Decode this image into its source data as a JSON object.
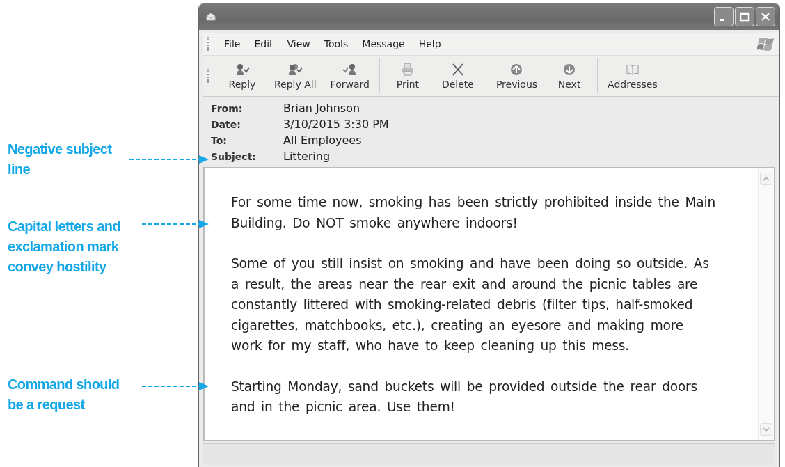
{
  "callouts": [
    {
      "text": "Negative subject line"
    },
    {
      "text": "Capital letters and exclamation mark convey hostility"
    },
    {
      "text": "Command should be a request"
    }
  ],
  "window": {
    "menu": [
      "File",
      "Edit",
      "View",
      "Tools",
      "Message",
      "Help"
    ],
    "toolbar_groups": [
      [
        {
          "label": "Reply",
          "kind": "reply"
        },
        {
          "label": "Reply All",
          "kind": "replyall"
        },
        {
          "label": "Forward",
          "kind": "forward"
        }
      ],
      [
        {
          "label": "Print",
          "kind": "print"
        },
        {
          "label": "Delete",
          "kind": "delete"
        }
      ],
      [
        {
          "label": "Previous",
          "kind": "previous"
        },
        {
          "label": "Next",
          "kind": "next"
        }
      ],
      [
        {
          "label": "Addresses",
          "kind": "addresses"
        }
      ]
    ],
    "header": [
      {
        "label": "From:",
        "value": "Brian Johnson"
      },
      {
        "label": "Date:",
        "value": "3/10/2015 3:30 PM"
      },
      {
        "label": "To:",
        "value": "All Employees"
      },
      {
        "label": "Subject:",
        "value": "Littering"
      }
    ],
    "body": [
      "For some time now, smoking has been strictly prohibited inside the Main Building. Do NOT smoke anywhere indoors!",
      "Some of you still insist on smoking and have been doing so outside. As a result, the areas near the rear exit and around the picnic tables are constantly littered with smoking-related debris (filter tips, half-smoked cigarettes, matchbooks, etc.), creating an eyesore and making more work for my staff, who have to keep cleaning up this mess.",
      "Starting Monday, sand buckets will be provided outside the rear doors and in the picnic area. Use them!"
    ]
  }
}
